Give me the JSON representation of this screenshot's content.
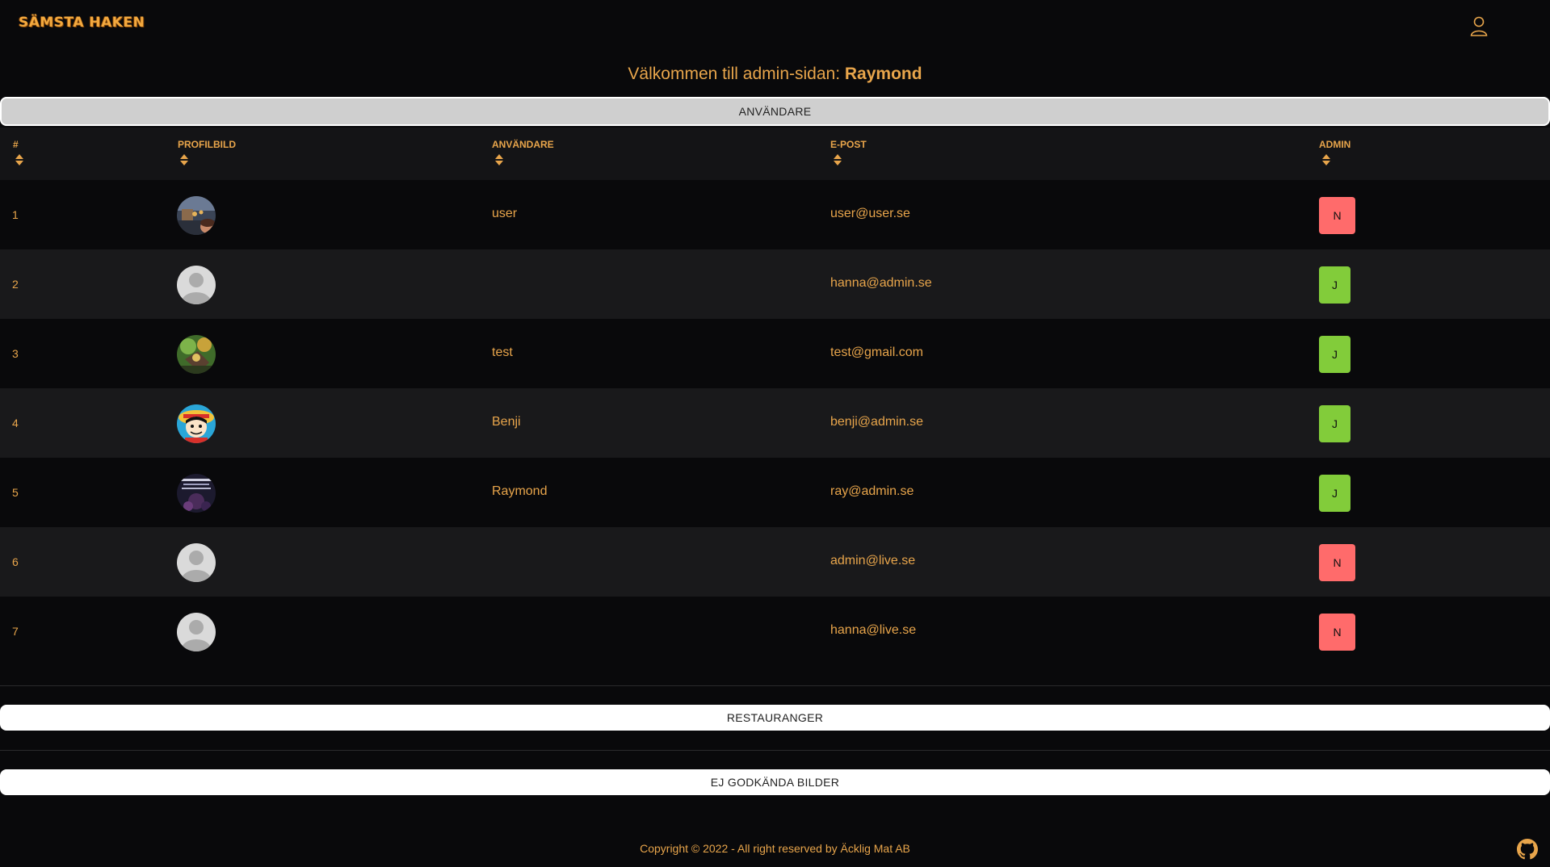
{
  "navbar": {
    "logo_text": "SÄMSTA HAKEN"
  },
  "welcome": {
    "prefix": "Välkommen till admin-sidan:",
    "name": "Raymond"
  },
  "sections": {
    "users_label": "ANVÄNDARE",
    "restaurants_label": "RESTAURANGER",
    "unapproved_label": "EJ GODKÄNDA BILDER"
  },
  "table": {
    "headers": [
      "#",
      "PROFILBILD",
      "ANVÄNDARE",
      "E-POST",
      "ADMIN"
    ],
    "rows": [
      {
        "index": "1",
        "avatar": "photo-avatar-crowd",
        "username": "user",
        "email": "user@user.se",
        "admin": "N"
      },
      {
        "index": "2",
        "avatar": "default-avatar",
        "username": "",
        "email": "hanna@admin.se",
        "admin": "J"
      },
      {
        "index": "3",
        "avatar": "photo-avatar-game",
        "username": "test",
        "email": "test@gmail.com",
        "admin": "J"
      },
      {
        "index": "4",
        "avatar": "photo-avatar-cartoon",
        "username": "Benji",
        "email": "benji@admin.se",
        "admin": "J"
      },
      {
        "index": "5",
        "avatar": "photo-avatar-dark",
        "username": "Raymond",
        "email": "ray@admin.se",
        "admin": "J"
      },
      {
        "index": "6",
        "avatar": "default-avatar",
        "username": "",
        "email": "admin@live.se",
        "admin": "N"
      },
      {
        "index": "7",
        "avatar": "default-avatar",
        "username": "",
        "email": "hanna@live.se",
        "admin": "N"
      }
    ]
  },
  "footer": {
    "copyright": "Copyright © 2022 - All right reserved by Äcklig Mat AB"
  },
  "colors": {
    "accent": "#e8a54b",
    "background": "#09090b",
    "admin_yes": "#82cc3a",
    "admin_no": "#ff6b6b"
  }
}
